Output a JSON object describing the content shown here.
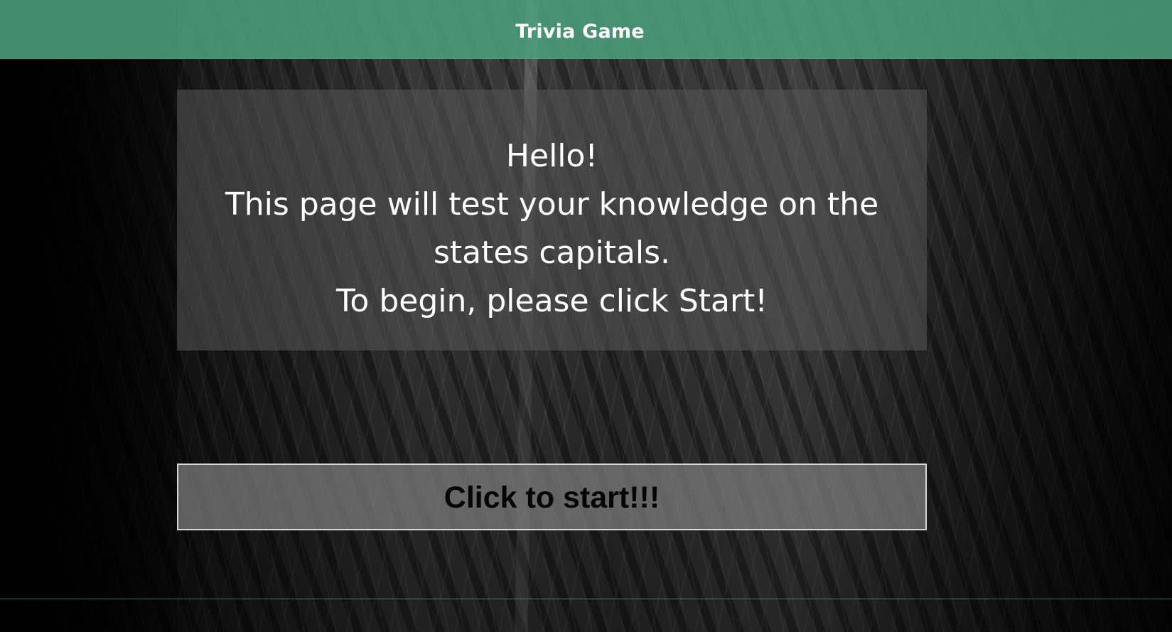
{
  "header": {
    "title": "Trivia Game"
  },
  "intro": {
    "greeting": "Hello!",
    "description": "This page will test your knowledge on the states capitals.",
    "instruction": "To begin, please click Start!"
  },
  "actions": {
    "start_label": "Click to start!!!"
  },
  "colors": {
    "header_background": "#4c9e7c",
    "text": "#ffffff",
    "start_button_text": "#050505"
  }
}
